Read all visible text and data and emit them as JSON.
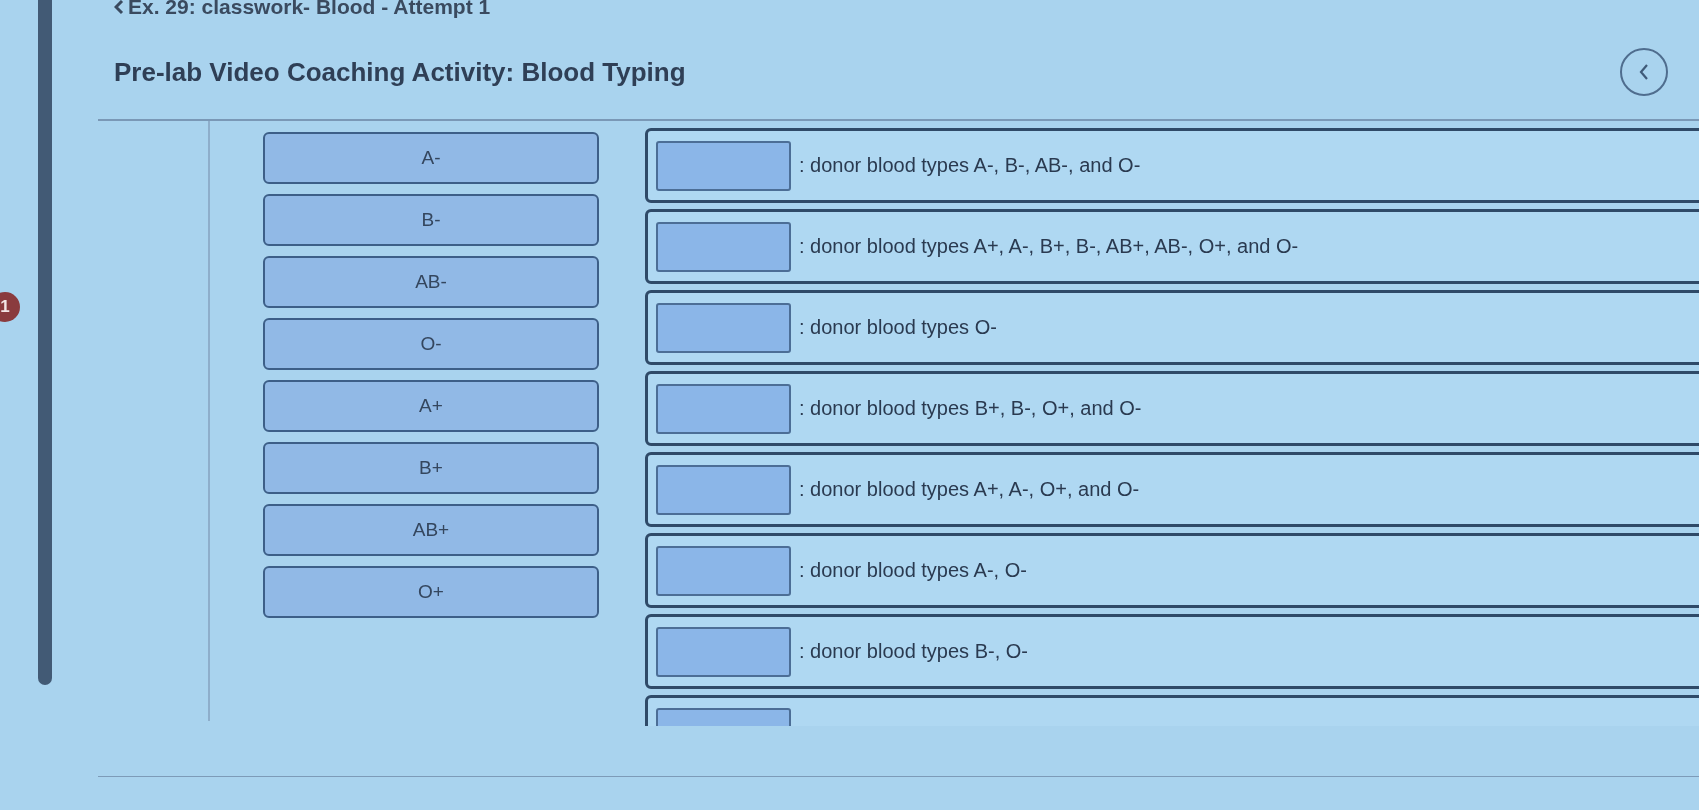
{
  "question_badge": "1",
  "breadcrumb": {
    "text": "Ex. 29: classwork- Blood - Attempt 1"
  },
  "title": "Pre-lab Video Coaching Activity: Blood Typing",
  "options": [
    {
      "label": "A-"
    },
    {
      "label": "B-"
    },
    {
      "label": "AB-"
    },
    {
      "label": "O-"
    },
    {
      "label": "A+"
    },
    {
      "label": "B+"
    },
    {
      "label": "AB+"
    },
    {
      "label": "O+"
    }
  ],
  "targets": [
    {
      "text": ": donor blood types A-, B-, AB-, and O-"
    },
    {
      "text": ": donor blood types A+, A-, B+, B-, AB+, AB-, O+, and O-"
    },
    {
      "text": ": donor blood types O-"
    },
    {
      "text": ": donor blood types B+, B-, O+, and O-"
    },
    {
      "text": ": donor blood types A+, A-, O+, and O-"
    },
    {
      "text": ": donor blood types A-, O-"
    },
    {
      "text": ": donor blood types B-, O-"
    }
  ],
  "more_rows_below": true
}
